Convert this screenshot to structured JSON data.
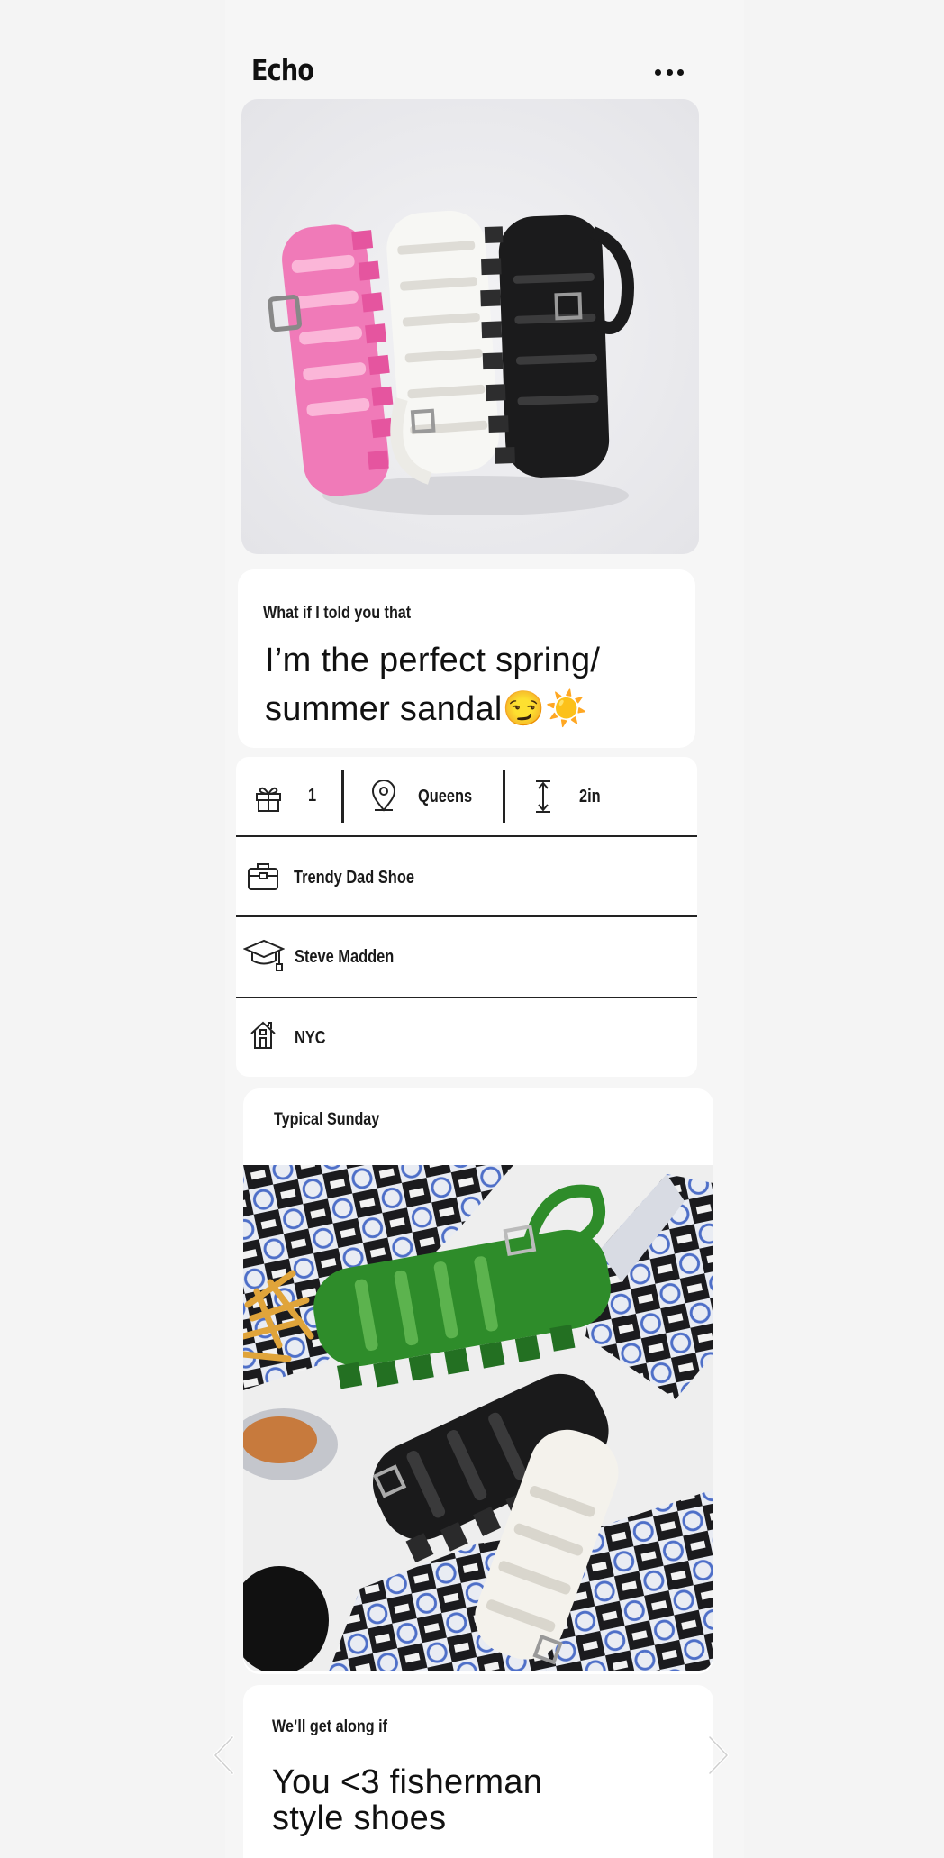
{
  "profile": {
    "name": "Echo"
  },
  "header": {
    "menu_icon": "more-horizontal-icon"
  },
  "photos": [
    {
      "alt": "pink, white and black fisherman sandals"
    },
    {
      "alt": "green, black and white fisherman sandals with fries"
    }
  ],
  "prompt1": {
    "label": "What if I told you that",
    "answer_line1": "I’m the perfect spring/",
    "answer_line2": "summer sandal😏☀️"
  },
  "details": {
    "gift": {
      "icon": "gift-icon",
      "value": "1"
    },
    "location": {
      "icon": "location-pin-icon",
      "value": "Queens"
    },
    "height": {
      "icon": "height-icon",
      "value": "2in"
    },
    "job": {
      "icon": "briefcase-icon",
      "value": "Trendy Dad Shoe"
    },
    "school": {
      "icon": "graduation-cap-icon",
      "value": "Steve Madden"
    },
    "hometown": {
      "icon": "home-icon",
      "value": "NYC"
    }
  },
  "prompt2": {
    "label": "Typical Sunday"
  },
  "prompt3": {
    "label": "We’ll get along if",
    "answer_line1": "You <3 fisherman",
    "answer_line2": "style shoes"
  },
  "nav": {
    "prev_icon": "chevron-left-icon",
    "next_icon": "chevron-right-icon"
  }
}
